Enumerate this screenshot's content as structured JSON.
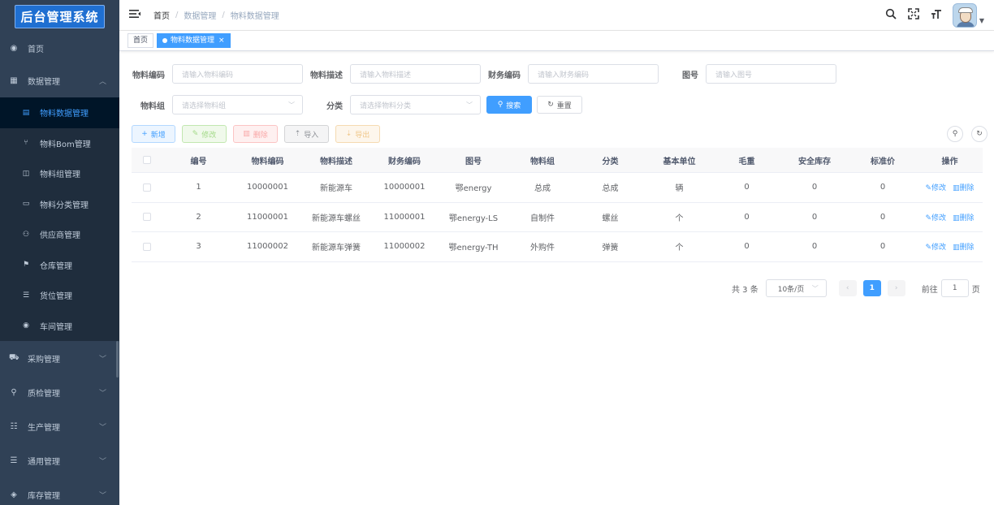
{
  "app": {
    "logo_text": "后台管理系统"
  },
  "sidebar": {
    "items": [
      {
        "label": "首页",
        "icon": "dashboard-icon",
        "glyph": "◉"
      },
      {
        "label": "数据管理",
        "icon": "grid-icon",
        "glyph": "▦",
        "arrow": "︿"
      }
    ],
    "subitems": [
      {
        "label": "物料数据管理",
        "icon": "document-icon",
        "glyph": "▤",
        "active": true
      },
      {
        "label": "物料Bom管理",
        "icon": "tree-icon",
        "glyph": "⑂"
      },
      {
        "label": "物料组管理",
        "icon": "table-icon",
        "glyph": "◫"
      },
      {
        "label": "物料分类管理",
        "icon": "tag-icon",
        "glyph": "▭"
      },
      {
        "label": "供应商管理",
        "icon": "users-icon",
        "glyph": "⚇"
      },
      {
        "label": "仓库管理",
        "icon": "warehouse-icon",
        "glyph": "⚑"
      },
      {
        "label": "货位管理",
        "icon": "list-icon",
        "glyph": "☰"
      },
      {
        "label": "车间管理",
        "icon": "radio-icon",
        "glyph": "◉"
      }
    ],
    "bottom": [
      {
        "label": "采购管理",
        "icon": "cart-icon",
        "glyph": "⛟",
        "arrow": "﹀"
      },
      {
        "label": "质检管理",
        "icon": "search-icon",
        "glyph": "⚲",
        "arrow": "﹀"
      },
      {
        "label": "生产管理",
        "icon": "sliders-icon",
        "glyph": "☷",
        "arrow": "﹀"
      },
      {
        "label": "通用管理",
        "icon": "list-icon",
        "glyph": "☰",
        "arrow": "﹀"
      },
      {
        "label": "库存管理",
        "icon": "layers-icon",
        "glyph": "◈",
        "arrow": "﹀"
      }
    ]
  },
  "topbar": {
    "breadcrumb": [
      "首页",
      "数据管理",
      "物料数据管理"
    ],
    "separator": "/"
  },
  "tags": {
    "home": "首页",
    "active": "物料数据管理",
    "close": "×"
  },
  "search": {
    "code_label": "物料编码",
    "code_placeholder": "请输入物料编码",
    "desc_label": "物料描述",
    "desc_placeholder": "请输入物料描述",
    "fin_label": "财务编码",
    "fin_placeholder": "请输入财务编码",
    "drawing_label": "图号",
    "drawing_placeholder": "请输入图号",
    "group_label": "物料组",
    "group_placeholder": "请选择物料组",
    "category_label": "分类",
    "category_placeholder": "请选择物料分类",
    "search_btn": "搜索",
    "reset_btn": "重置"
  },
  "toolbar": {
    "add": "新增",
    "edit": "修改",
    "delete": "删除",
    "import": "导入",
    "export": "导出"
  },
  "table": {
    "headers": [
      "编号",
      "物料编码",
      "物料描述",
      "财务编码",
      "图号",
      "物料组",
      "分类",
      "基本单位",
      "毛重",
      "安全库存",
      "标准价",
      "操作"
    ],
    "rows": [
      [
        "1",
        "10000001",
        "新能源车",
        "10000001",
        "鄂energy",
        "总成",
        "总成",
        "辆",
        "0",
        "0",
        "0"
      ],
      [
        "2",
        "11000001",
        "新能源车螺丝",
        "11000001",
        "鄂energy-LS",
        "自制件",
        "螺丝",
        "个",
        "0",
        "0",
        "0"
      ],
      [
        "3",
        "11000002",
        "新能源车弹簧",
        "11000002",
        "鄂energy-TH",
        "外购件",
        "弹簧",
        "个",
        "0",
        "0",
        "0"
      ]
    ],
    "row_edit": "修改",
    "row_delete": "删除"
  },
  "pagination": {
    "total": "共 3 条",
    "page_size": "10条/页",
    "current": "1",
    "goto_label": "前往",
    "goto_value": "1",
    "page_unit": "页"
  },
  "colors": {
    "sidebar_bg": "#304156",
    "sidebar_sub_bg": "#1f2d3d",
    "accent": "#409eff"
  }
}
